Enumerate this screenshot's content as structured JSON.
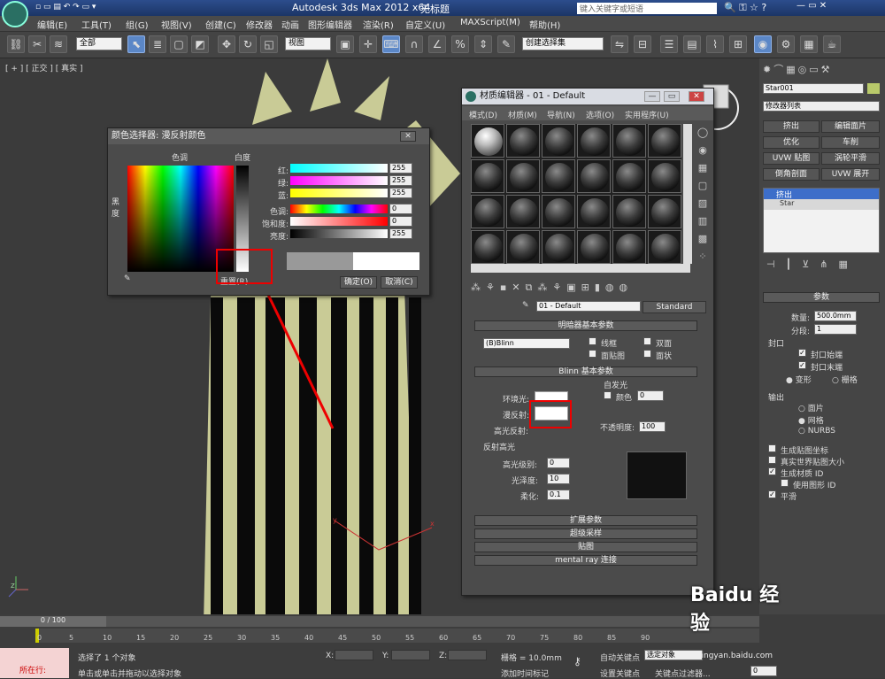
{
  "title_bar": {
    "app_title": "Autodesk 3ds Max  2012 x64",
    "doc": "无标题",
    "search_placeholder": "键入关键字或短语"
  },
  "menu": [
    "编辑(E)",
    "工具(T)",
    "组(G)",
    "视图(V)",
    "创建(C)",
    "修改器",
    "动画",
    "图形编辑器",
    "渲染(R)",
    "自定义(U)",
    "MAXScript(M)",
    "帮助(H)"
  ],
  "toolbar": {
    "selection_filter": "全部",
    "ref_coord": "视图",
    "named_sel": "创建选择集"
  },
  "viewport": {
    "label": "[ + ] [ 正交 ] [ 真实 ]"
  },
  "color_picker": {
    "title": "颜色选择器: 漫反射颜色",
    "hue_label": "色调",
    "white_label": "白度",
    "black_label": "黑\n度",
    "rows": [
      {
        "label": "红:",
        "value": "255"
      },
      {
        "label": "绿:",
        "value": "255"
      },
      {
        "label": "蓝:",
        "value": "255"
      },
      {
        "label": "色调:",
        "value": "0"
      },
      {
        "label": "饱和度:",
        "value": "0"
      },
      {
        "label": "亮度:",
        "value": "255"
      }
    ],
    "reset": "重置(R)",
    "ok": "确定(O)",
    "cancel": "取消(C)"
  },
  "material_editor": {
    "title": "材质编辑器 - 01 - Default",
    "menu": [
      "模式(D)",
      "材质(M)",
      "导航(N)",
      "选项(O)",
      "实用程序(U)"
    ],
    "material_name": "01 - Default",
    "shader_type": "Standard",
    "shader_rollout": "明暗器基本参数",
    "shader": "(B)Blinn",
    "opts": [
      "线框",
      "双面",
      "面贴图",
      "面状"
    ],
    "blinn_rollout": "Blinn 基本参数",
    "self_illum": "自发光",
    "color_label": "颜色",
    "self_illum_value": "0",
    "ambient": "环境光:",
    "diffuse": "漫反射:",
    "specular": "高光反射:",
    "opacity_label": "不透明度:",
    "opacity": "100",
    "spec_group": "反射高光",
    "spec_level_label": "高光级别:",
    "spec_level": "0",
    "gloss_label": "光泽度:",
    "gloss": "10",
    "soften_label": "柔化:",
    "soften": "0.1",
    "rollouts": [
      "扩展参数",
      "超级采样",
      "贴图",
      "mental ray 连接"
    ]
  },
  "right_panel": {
    "object_name": "Star001",
    "modifier_list": "修改器列表",
    "buttons": [
      "挤出",
      "编辑面片",
      "优化",
      "车削",
      "UVW 贴图",
      "涡轮平滑",
      "倒角剖面",
      "UVW 展开"
    ],
    "stack": [
      "挤出",
      "Star"
    ],
    "params_title": "参数",
    "amount_label": "数量:",
    "amount": "500.0mm",
    "segments_label": "分段:",
    "segments": "1",
    "capping": "封口",
    "cap_start": "封口始端",
    "cap_end": "封口末端",
    "morph": "变形",
    "grid": "栅格",
    "output": "输出",
    "out_patch": "面片",
    "out_mesh": "网格",
    "out_nurbs": "NURBS",
    "gen_map": "生成贴图坐标",
    "real_world": "真实世界贴图大小",
    "gen_mat_id": "生成材质 ID",
    "use_shape_id": "使用图形 ID",
    "smooth": "平滑"
  },
  "timeline": {
    "frame": "0 / 100",
    "ticks": [
      "0",
      "5",
      "10",
      "15",
      "20",
      "25",
      "30",
      "35",
      "40",
      "45",
      "50",
      "55",
      "60",
      "65",
      "70",
      "75",
      "80",
      "85",
      "90"
    ]
  },
  "status": {
    "selected": "选择了 1 个对象",
    "prompt": "单击或单击并拖动以选择对象",
    "x": "X:",
    "y": "Y:",
    "z": "Z:",
    "grid": "栅格 = 10.0mm",
    "autokey": "自动关键点",
    "setkey": "设置关键点",
    "key_sel": "选定对象",
    "key_filter": "关键点过滤器...",
    "add_time": "添加时间标记",
    "script": "所在行:",
    "frame_field": "0"
  },
  "watermark": {
    "logo": "Baidu 经验",
    "url": "jingyan.baidu.com"
  }
}
